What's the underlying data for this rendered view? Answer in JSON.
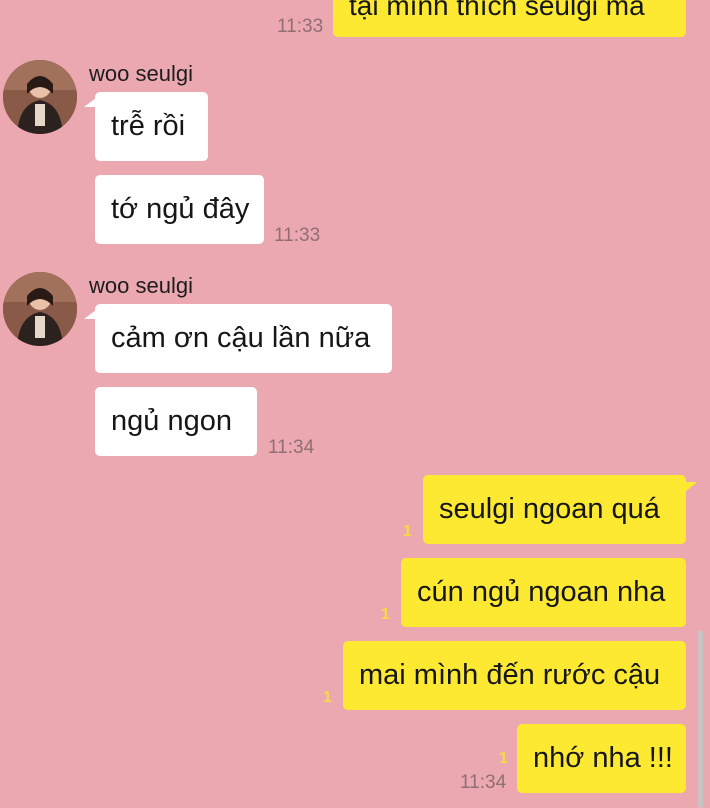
{
  "chat": {
    "messages": [
      {
        "id": "m0",
        "text": "tại mình thích seulgi mà",
        "time": "11:33"
      },
      {
        "id": "g1",
        "sender": "woo seulgi",
        "lines": [
          {
            "text": "trễ rồi"
          },
          {
            "text": "tớ ngủ đây",
            "time": "11:33"
          }
        ]
      },
      {
        "id": "g2",
        "sender": "woo seulgi",
        "lines": [
          {
            "text": "cảm ơn cậu lần nữa"
          },
          {
            "text": "ngủ ngon",
            "time": "11:34"
          }
        ]
      },
      {
        "id": "g3",
        "lines": [
          {
            "text": "seulgi ngoan quá",
            "unread": "1"
          },
          {
            "text": "cún ngủ ngoan nha",
            "unread": "1"
          },
          {
            "text": "mai mình đến rước cậu",
            "unread": "1"
          },
          {
            "text": "nhớ nha !!!",
            "unread": "1",
            "time": "11:34"
          }
        ]
      }
    ]
  },
  "colors": {
    "background": "#eca8b0",
    "outgoing_bubble": "#fde932",
    "incoming_bubble": "#ffffff"
  }
}
